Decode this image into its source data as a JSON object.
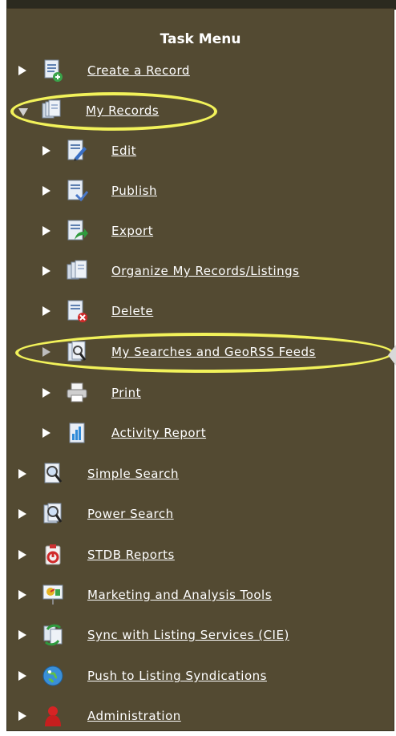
{
  "menu": {
    "title": "Task Menu",
    "items": [
      {
        "label": "Create a Record",
        "icon": "document-add-icon",
        "level": 0,
        "expanded": false
      },
      {
        "label": "My Records",
        "icon": "records-stack-icon",
        "level": 0,
        "expanded": true
      },
      {
        "label": "Edit",
        "icon": "document-edit-icon",
        "level": 1,
        "expanded": false
      },
      {
        "label": "Publish",
        "icon": "document-publish-icon",
        "level": 1,
        "expanded": false
      },
      {
        "label": "Export",
        "icon": "document-export-icon",
        "level": 1,
        "expanded": false
      },
      {
        "label": "Organize My Records/Listings",
        "icon": "records-organize-icon",
        "level": 1,
        "expanded": false
      },
      {
        "label": "Delete",
        "icon": "document-delete-icon",
        "level": 1,
        "expanded": false
      },
      {
        "label": "My Searches and GeoRSS Feeds",
        "icon": "saved-search-icon",
        "level": 1,
        "expanded": false
      },
      {
        "label": "Print",
        "icon": "printer-icon",
        "level": 1,
        "expanded": false
      },
      {
        "label": "Activity Report",
        "icon": "activity-report-icon",
        "level": 1,
        "expanded": false
      },
      {
        "label": "Simple Search",
        "icon": "search-document-icon",
        "level": 0,
        "expanded": false
      },
      {
        "label": "Power Search",
        "icon": "power-search-icon",
        "level": 0,
        "expanded": false
      },
      {
        "label": "STDB Reports",
        "icon": "clipboard-report-icon",
        "level": 0,
        "expanded": false
      },
      {
        "label": "Marketing and Analysis Tools",
        "icon": "marketing-tools-icon",
        "level": 0,
        "expanded": false
      },
      {
        "label": "Sync with Listing Services (CIE)",
        "icon": "sync-icon",
        "level": 0,
        "expanded": false
      },
      {
        "label": "Push to Listing Syndications",
        "icon": "globe-icon",
        "level": 0,
        "expanded": false
      },
      {
        "label": "Administration",
        "icon": "admin-icon",
        "level": 0,
        "expanded": false
      }
    ]
  },
  "colors": {
    "panel_bg": "#534a32",
    "highlight": "#f2f25a",
    "text": "#ffffff"
  }
}
